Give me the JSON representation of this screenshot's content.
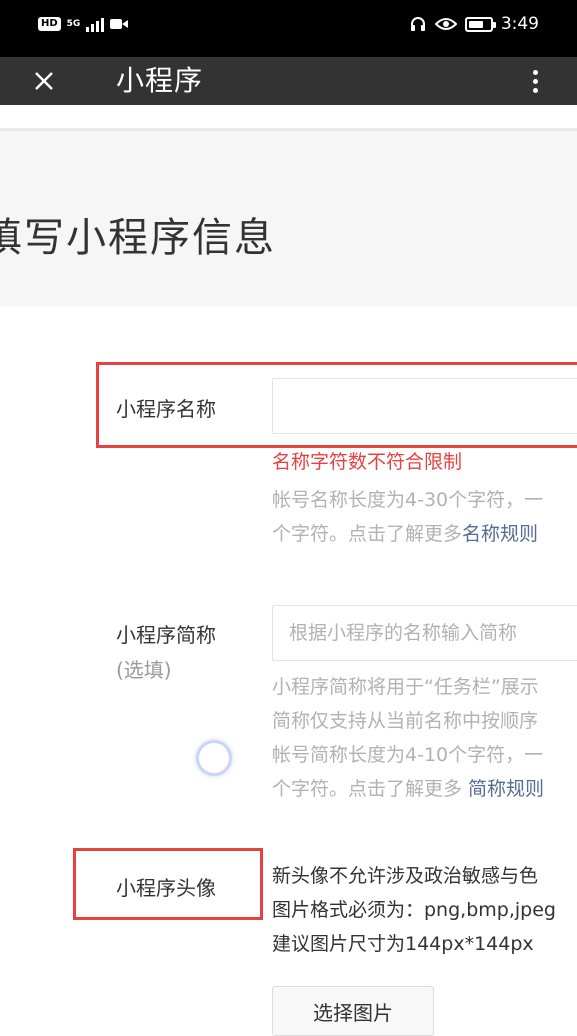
{
  "status_bar": {
    "hd_badge": "HD",
    "network": "5G",
    "time": "3:49",
    "icons": [
      "signal-icon",
      "video-icon",
      "headphones-icon",
      "eye-icon",
      "battery-icon"
    ],
    "battery_level": 0.7
  },
  "nav": {
    "title": "小程序",
    "close_icon": "close-icon",
    "more_icon": "more-vertical-icon"
  },
  "page": {
    "title": "填写小程序信息"
  },
  "form": {
    "name": {
      "label": "小程序名称",
      "value": "",
      "error": "名称字符数不符合限制",
      "tip_line1": "帐号名称长度为4-30个字符，一",
      "tip_line2_prefix": "个字符。点击了解更多",
      "tip_line2_link": "名称规则"
    },
    "short_name": {
      "label": "小程序简称",
      "optional": "(选填)",
      "placeholder": "根据小程序的名称输入简称",
      "tip_line1": "小程序简称将用于“任务栏”展示",
      "tip_line2": "简称仅支持从当前名称中按顺序",
      "tip_line3": "帐号简称长度为4-10个字符，一",
      "tip_line4_prefix": "个字符。点击了解更多 ",
      "tip_line4_link": "简称规则"
    },
    "avatar": {
      "label": "小程序头像",
      "desc_line1": "新头像不允许涉及政治敏感与色",
      "desc_line2": "图片格式必须为：png,bmp,jpeg",
      "desc_line3": "建议图片尺寸为144px*144px",
      "button_label": "选择图片"
    }
  },
  "colors": {
    "nav_bg": "#333333",
    "error": "#e64340",
    "link": "#576b95",
    "tip": "#b2b2b2"
  }
}
